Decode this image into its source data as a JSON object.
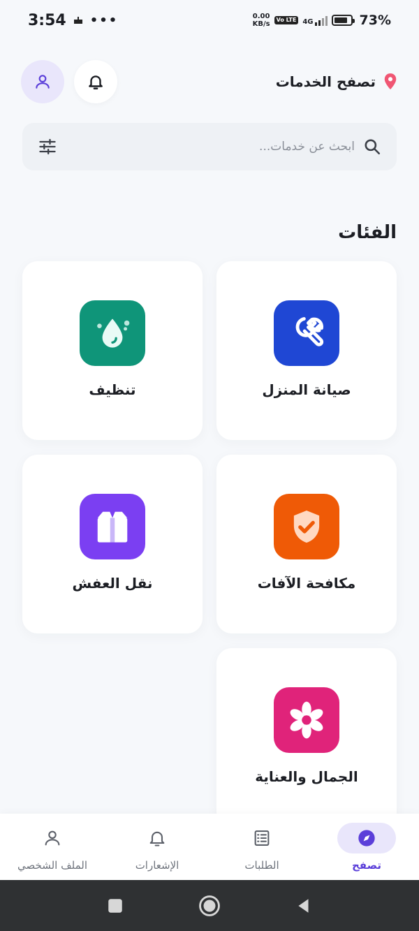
{
  "status_bar": {
    "time": "3:54",
    "speed_value": "0.00",
    "speed_unit": "KB/s",
    "volte": "Vo LTE",
    "network": "4G",
    "battery": "73%"
  },
  "header": {
    "title": "تصفح الخدمات",
    "location_icon": "location-pin-icon",
    "bell_icon": "bell-icon",
    "profile_icon": "user-icon"
  },
  "search": {
    "placeholder": "ابحث عن خدمات..."
  },
  "categories": {
    "title": "الفئات",
    "items": [
      {
        "label": "صيانة المنزل",
        "icon": "wrench-icon",
        "color": "#1f47d4"
      },
      {
        "label": "تنظيف",
        "icon": "water-drop-icon",
        "color": "#0f9579"
      },
      {
        "label": "مكافحة الآفات",
        "icon": "shield-check-icon",
        "color": "#ef5a06"
      },
      {
        "label": "نقل العفش",
        "icon": "box-icon",
        "color": "#7b3ff2"
      },
      {
        "label": "الجمال والعناية",
        "icon": "flower-icon",
        "color": "#e0237a"
      }
    ]
  },
  "bottom_nav": {
    "items": [
      {
        "label": "تصفح",
        "icon": "compass-icon",
        "active": true
      },
      {
        "label": "الطلبات",
        "icon": "orders-list-icon",
        "active": false
      },
      {
        "label": "الإشعارات",
        "icon": "bell-icon",
        "active": false
      },
      {
        "label": "الملف الشخصي",
        "icon": "user-icon",
        "active": false
      }
    ]
  },
  "colors": {
    "accent": "#5b3fd9",
    "accent_soft": "#e9e6fb",
    "location_pin": "#f05673",
    "background": "#f6f8fb"
  }
}
